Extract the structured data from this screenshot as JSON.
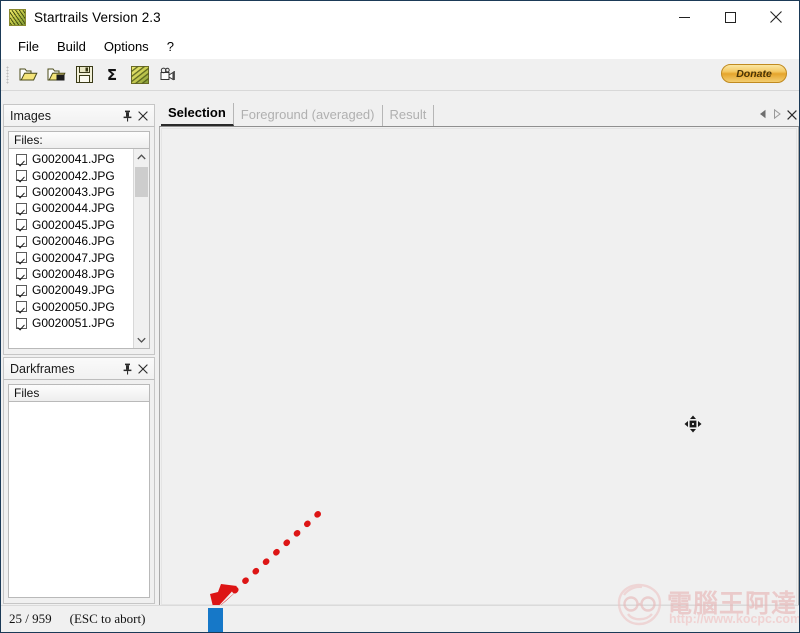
{
  "window": {
    "title": "Startrails Version 2.3",
    "icon": "startrails-app-icon",
    "controls": {
      "minimize": "minimize-icon",
      "maximize": "maximize-icon",
      "close": "close-icon"
    }
  },
  "menu": {
    "items": [
      {
        "label": "File"
      },
      {
        "label": "Build"
      },
      {
        "label": "Options"
      },
      {
        "label": "?"
      }
    ]
  },
  "toolbar": {
    "buttons": [
      {
        "name": "open-folder-icon",
        "tooltip": "Open"
      },
      {
        "name": "open-dark-folder-icon",
        "tooltip": "Open darkframes"
      },
      {
        "name": "save-icon",
        "tooltip": "Save"
      },
      {
        "name": "sigma-icon",
        "label": "Σ",
        "tooltip": "Sum"
      },
      {
        "name": "startrails-icon",
        "tooltip": "Startrails"
      },
      {
        "name": "video-icon",
        "tooltip": "Video"
      }
    ],
    "donate_label": "Donate"
  },
  "panels": {
    "images": {
      "title": "Images",
      "pin_icon": "pin-icon",
      "close_icon": "close-icon",
      "list_header": "Files:",
      "files": [
        {
          "name": "G0020041.JPG",
          "checked": true
        },
        {
          "name": "G0020042.JPG",
          "checked": true
        },
        {
          "name": "G0020043.JPG",
          "checked": true
        },
        {
          "name": "G0020044.JPG",
          "checked": true
        },
        {
          "name": "G0020045.JPG",
          "checked": true
        },
        {
          "name": "G0020046.JPG",
          "checked": true
        },
        {
          "name": "G0020047.JPG",
          "checked": true
        },
        {
          "name": "G0020048.JPG",
          "checked": true
        },
        {
          "name": "G0020049.JPG",
          "checked": true
        },
        {
          "name": "G0020050.JPG",
          "checked": true
        },
        {
          "name": "G0020051.JPG",
          "checked": true
        }
      ]
    },
    "darkframes": {
      "title": "Darkframes",
      "pin_icon": "pin-icon",
      "close_icon": "close-icon",
      "list_header": "Files",
      "files": []
    }
  },
  "tabs": {
    "items": [
      {
        "label": "Selection",
        "active": true
      },
      {
        "label": "Foreground (averaged)",
        "active": false
      },
      {
        "label": "Result",
        "active": false
      }
    ],
    "nav": {
      "prev": "chevron-left-icon",
      "next": "chevron-right-icon",
      "close": "close-icon"
    }
  },
  "canvas": {
    "cursor": "move-cursor-icon"
  },
  "statusbar": {
    "progress_text": "25 / 959",
    "hint_text": "(ESC to abort)",
    "progress_value": 25,
    "progress_max": 959,
    "progress_color": "#1678c8"
  },
  "annotation": {
    "arrow": "red-dotted-arrow",
    "color": "#dd1515"
  },
  "watermark": {
    "brand": "電腦王阿達",
    "url": "http://www.kocpc.com.tw",
    "face_icon": "smiling-face-logo"
  }
}
